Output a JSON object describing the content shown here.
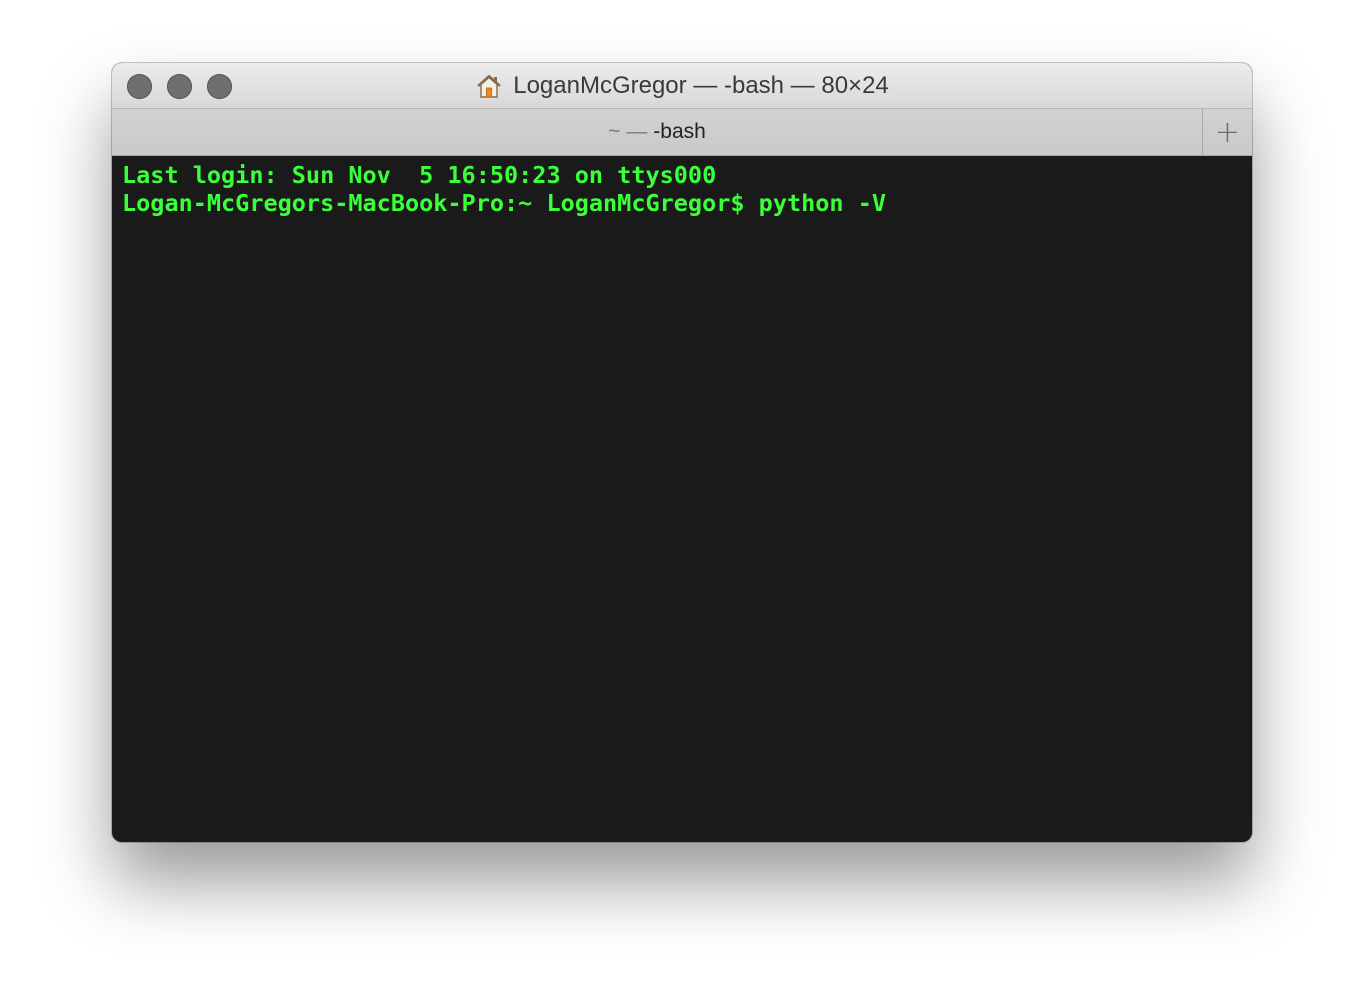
{
  "window": {
    "title": "LoganMcGregor — -bash — 80×24",
    "title_icon": "home-icon"
  },
  "tab": {
    "prefix": "~ —",
    "label": "-bash",
    "new_tab_icon": "plus-icon"
  },
  "terminal": {
    "lines": [
      "Last login: Sun Nov  5 16:50:23 on ttys000",
      "Logan-McGregors-MacBook-Pro:~ LoganMcGregor$ python -V"
    ],
    "text_color": "#3aff3a",
    "background_color": "#1a1a1a"
  }
}
